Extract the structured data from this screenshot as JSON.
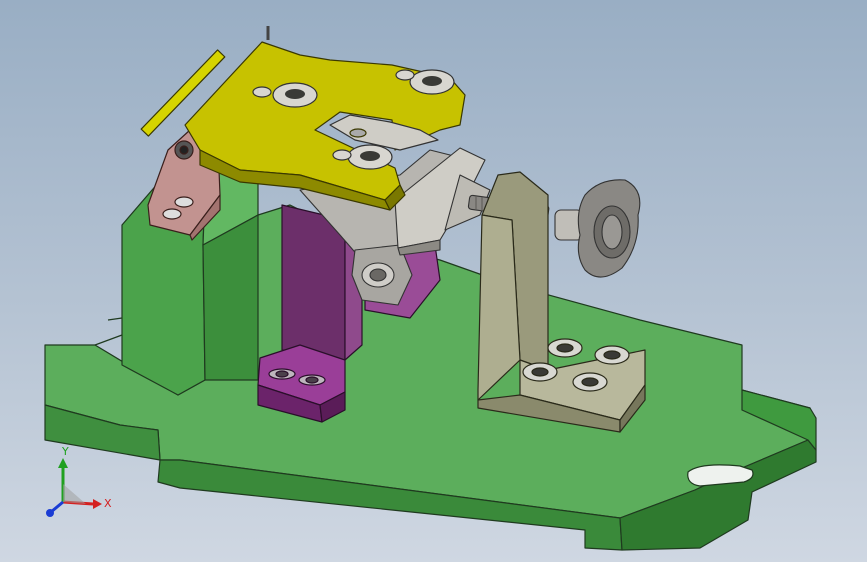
{
  "triad": {
    "x_label": "X",
    "y_label": "Y",
    "x_color": "#d42020",
    "y_color": "#20a020",
    "z_color": "#1a3cd4"
  },
  "colors": {
    "background_top": "#99aec4",
    "background_bottom": "#cfd7e2",
    "base_green": "#5fb35f",
    "clamp_yellow": "#c9c400",
    "support_magenta": "#8a3f86",
    "bracket_olive": "#a8a88a",
    "fixture_gray": "#c8c6c0",
    "hinge_pink": "#c89690"
  }
}
